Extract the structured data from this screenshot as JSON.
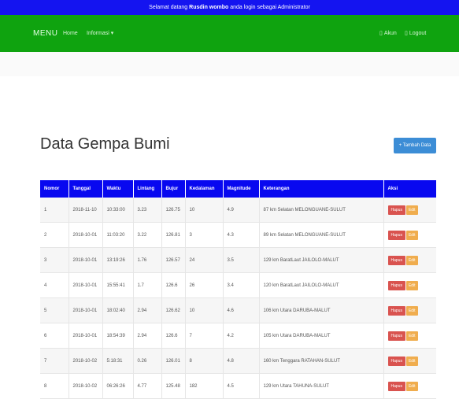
{
  "topbar": {
    "before": "Selamat datang ",
    "user": "Rusdin wombo",
    "after": " anda login sebagai Administrator"
  },
  "navbar": {
    "brand": "MENU",
    "home": "Home",
    "informasi": "Informasi ▾",
    "akun": "Akun",
    "logout": "Logout",
    "akun_icon": "user-icon",
    "logout_icon": "logout-icon"
  },
  "page": {
    "title": "Data Gempa Bumi",
    "add_label": "+ Tambah Data"
  },
  "table": {
    "headers": [
      "Nomor",
      "Tanggal",
      "Waktu",
      "Lintang",
      "Bujur",
      "Kedalaman",
      "Magnitude",
      "Keterangan",
      "Aksi"
    ],
    "rows": [
      [
        "1",
        "2018-11-10",
        "10:33:00",
        "3.23",
        "126.75",
        "10",
        "4.9",
        "87 km Selatan MELONGUANE-SULUT"
      ],
      [
        "2",
        "2018-10-01",
        "11:03:20",
        "3.22",
        "126.81",
        "3",
        "4.3",
        "89 km Selatan MELONGUANE-SULUT"
      ],
      [
        "3",
        "2018-10-01",
        "13:19:26",
        "1.76",
        "126.57",
        "24",
        "3.5",
        "129 km BaratLaut JAILOLO-MALUT"
      ],
      [
        "4",
        "2018-10-01",
        "15:55:41",
        "1.7",
        "126.6",
        "26",
        "3.4",
        "120 km BaratLaut JAILOLO-MALUT"
      ],
      [
        "5",
        "2018-10-01",
        "18:02:40",
        "2.94",
        "126.62",
        "10",
        "4.6",
        "106 km Utara DARUBA-MALUT"
      ],
      [
        "6",
        "2018-10-01",
        "18:54:39",
        "2.94",
        "126.6",
        "7",
        "4.2",
        "105 km Utara DARUBA-MALUT"
      ],
      [
        "7",
        "2018-10-02",
        "5:18:31",
        "0.26",
        "126.01",
        "8",
        "4.8",
        "160 km Tenggara RATAHAN-SULUT"
      ],
      [
        "8",
        "2018-10-02",
        "06:26:26",
        "4.77",
        "125.48",
        "182",
        "4.5",
        "129 km Utara TAHUNA-SULUT"
      ]
    ],
    "action_delete": "Hapus",
    "action_edit": "Edit"
  }
}
